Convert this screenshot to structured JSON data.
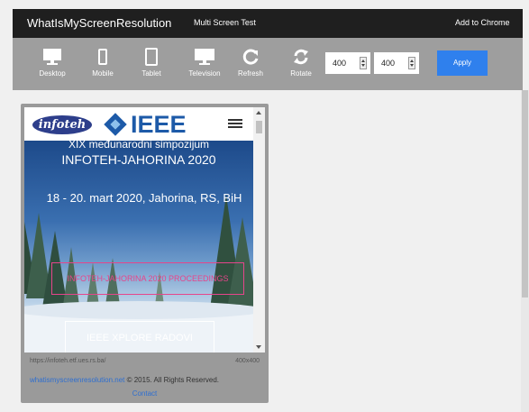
{
  "topbar": {
    "brand": "WhatIsMyScreenResolution",
    "multi_screen": "Multi Screen Test",
    "add_to_chrome": "Add to Chrome"
  },
  "toolbar": {
    "tools": [
      {
        "label": "Desktop",
        "icon": "desktop-icon"
      },
      {
        "label": "Mobile",
        "icon": "mobile-icon"
      },
      {
        "label": "Tablet",
        "icon": "tablet-icon"
      },
      {
        "label": "Television",
        "icon": "television-icon"
      },
      {
        "label": "Refresh",
        "icon": "refresh-icon"
      },
      {
        "label": "Rotate",
        "icon": "rotate-icon"
      }
    ],
    "width_value": "400",
    "height_value": "400",
    "apply_label": "Apply"
  },
  "site": {
    "logo_text": "infoteh",
    "ieee_text": "IEEE",
    "line1": "XIX međunarodni simpozijum",
    "line2": "INFOTEH-JAHORINA 2020",
    "line3": "18 - 20. mart 2020, Jahorina, RS, BiH",
    "cta_primary": "INFOTEH-JAHORINA 2020 PROCEEDINGS",
    "cta_secondary": "IEEE XPLORE RADOVI"
  },
  "footer": {
    "url": "https://infoteh.etf.ues.rs.ba/",
    "dims": "400x400",
    "site_link": "whatismyscreenresolution.net",
    "copyright": " © 2015. All Rights Reserved.",
    "contact": "Contact"
  },
  "colors": {
    "topbar": "#1f1f1f",
    "toolbar": "#9e9e9e",
    "apply": "#2f80ed",
    "ieee": "#1d5aa8",
    "cta_pink": "#e6458b"
  }
}
